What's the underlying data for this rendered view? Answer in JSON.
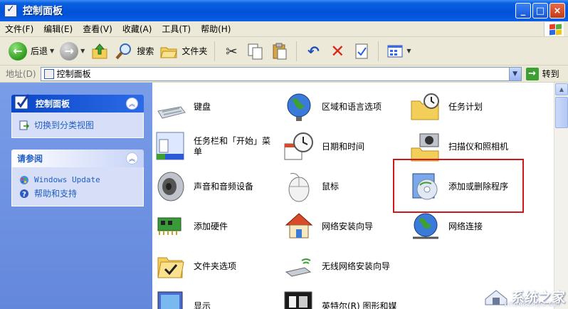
{
  "window": {
    "title": "控制面板",
    "buttons": {
      "minimize": "_",
      "maximize": "□",
      "close": "×"
    }
  },
  "menu": [
    "文件(F)",
    "编辑(E)",
    "查看(V)",
    "收藏(A)",
    "工具(T)",
    "帮助(H)"
  ],
  "toolbar": {
    "back_label": "后退",
    "search_label": "搜索",
    "folders_label": "文件夹"
  },
  "address": {
    "label": "地址(D)",
    "value": "控制面板",
    "go_label": "转到"
  },
  "left_pane": {
    "panel1": {
      "title": "控制面板",
      "link": "切换到分类视图"
    },
    "panel2": {
      "title": "请参阅",
      "links": [
        "Windows Update",
        "帮助和支持"
      ]
    }
  },
  "items": {
    "keyboard": "键盘",
    "regional": "区域和语言选项",
    "scheduled": "任务计划",
    "taskbar": "任务栏和「开始」菜单",
    "datetime": "日期和时间",
    "scanners": "扫描仪和照相机",
    "sound": "声音和音频设备",
    "mouse": "鼠标",
    "addremove": "添加或删除程序",
    "hardware": "添加硬件",
    "netwizard": "网络安装向导",
    "netconn": "网络连接",
    "folderopts": "文件夹选项",
    "wireless": "无线网络安装向导",
    "display": "显示",
    "intel": "英特尔(R) 图形和媒"
  },
  "watermark": {
    "text": "系统之家",
    "sub": "XITONGZHIJIA.NET"
  },
  "colors": {
    "titlebar": "#0052d6",
    "pane": "#6487dc",
    "link": "#215dc6",
    "highlight": "#d01818"
  }
}
